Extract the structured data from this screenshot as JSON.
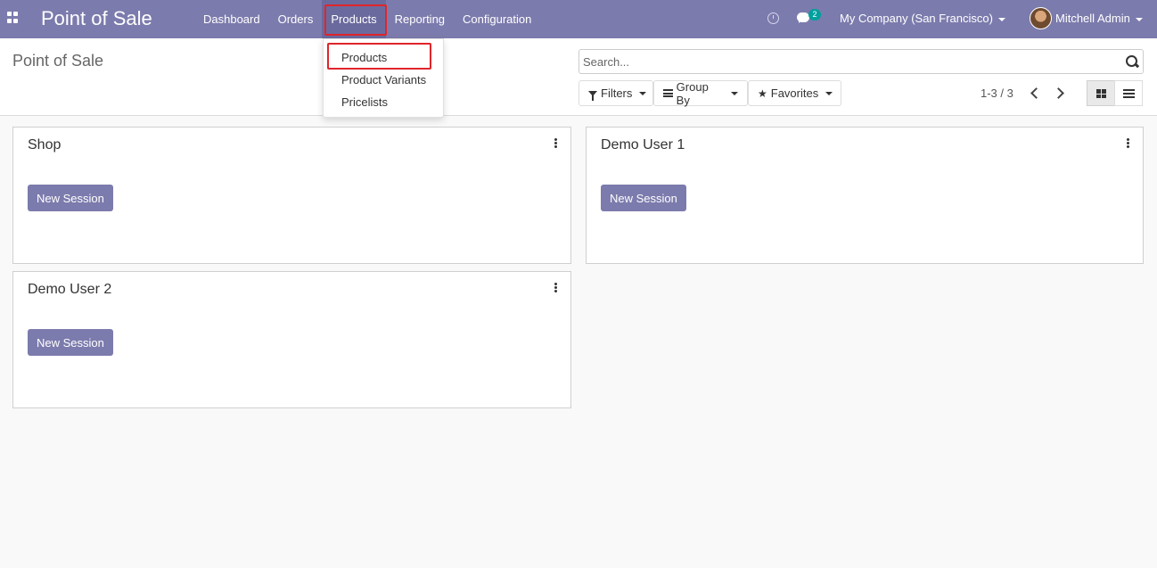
{
  "navbar": {
    "app_title": "Point of Sale",
    "menu": [
      "Dashboard",
      "Orders",
      "Products",
      "Reporting",
      "Configuration"
    ],
    "active_menu": "Products",
    "messages_badge": "2",
    "company": "My Company (San Francisco)",
    "user": "Mitchell Admin",
    "color": "#7c7bad"
  },
  "products_dropdown": [
    "Products",
    "Product Variants",
    "Pricelists"
  ],
  "control_panel": {
    "breadcrumb": "Point of Sale",
    "search_placeholder": "Search...",
    "filters_label": "Filters",
    "groupby_label": "Group By",
    "favorites_label": "Favorites",
    "pager": "1-3 / 3"
  },
  "cards": [
    {
      "title": "Shop",
      "button": "New Session"
    },
    {
      "title": "Demo User 1",
      "button": "New Session"
    },
    {
      "title": "Demo User 2",
      "button": "New Session"
    }
  ]
}
